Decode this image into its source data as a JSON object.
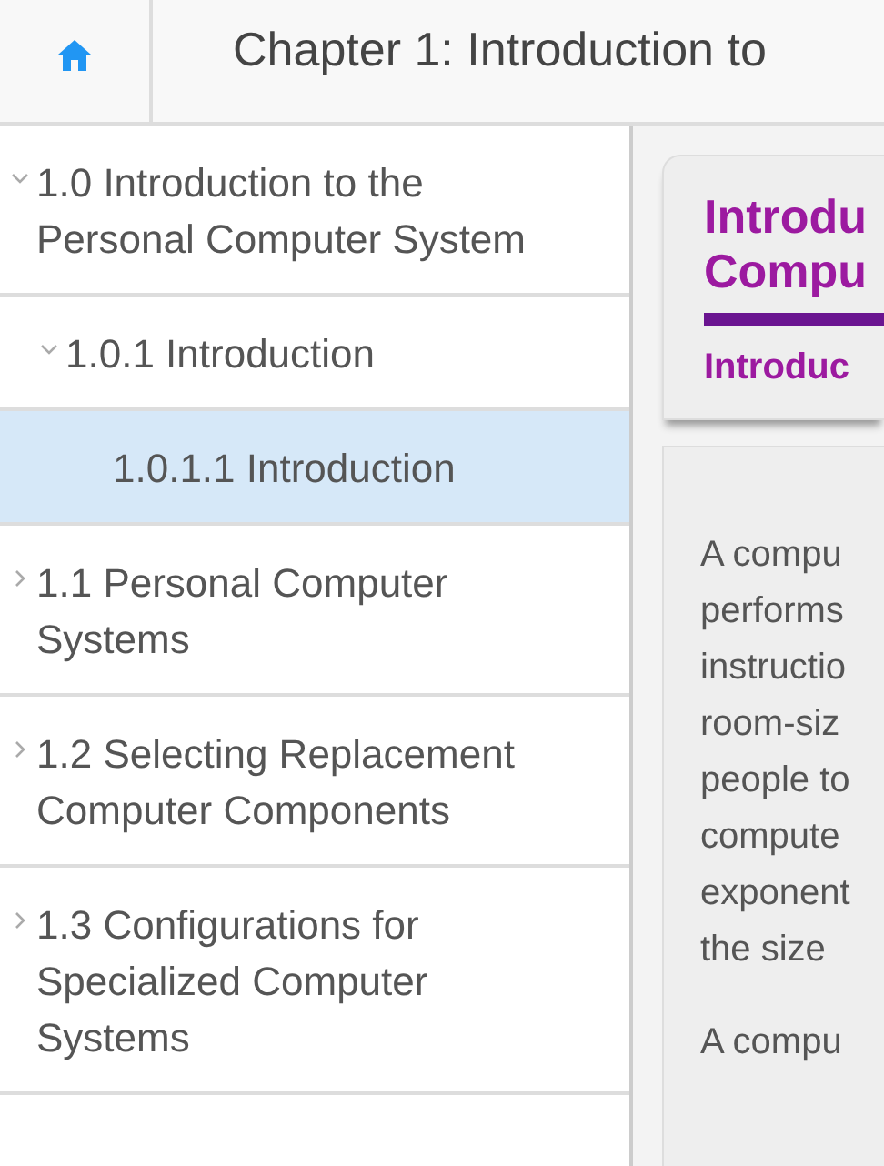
{
  "header": {
    "title": "Chapter 1: Introduction to"
  },
  "toc": [
    {
      "label": "1.0 Introduction to the Personal Computer System",
      "expanded": true,
      "selected": false,
      "children": [
        {
          "label": "1.0.1 Introduction",
          "expanded": true,
          "selected": false,
          "children": [
            {
              "label": "1.0.1.1 Introduction",
              "selected": true
            }
          ]
        }
      ]
    },
    {
      "label": "1.1 Personal Computer Systems",
      "expanded": false,
      "selected": false
    },
    {
      "label": "1.2 Selecting Replacement Computer Components",
      "expanded": false,
      "selected": false
    },
    {
      "label": "1.3 Configurations for Specialized Computer Systems",
      "expanded": false,
      "selected": false
    }
  ],
  "content": {
    "heading_lines": [
      "Introdu",
      "Compu"
    ],
    "subheading": "Introduc",
    "paragraphs": [
      {
        "lines": [
          "A compu",
          "performs",
          "instructio",
          "room-siz",
          "people to",
          "compute",
          "exponent",
          "the size"
        ]
      },
      {
        "lines": [
          "A compu"
        ]
      }
    ]
  }
}
